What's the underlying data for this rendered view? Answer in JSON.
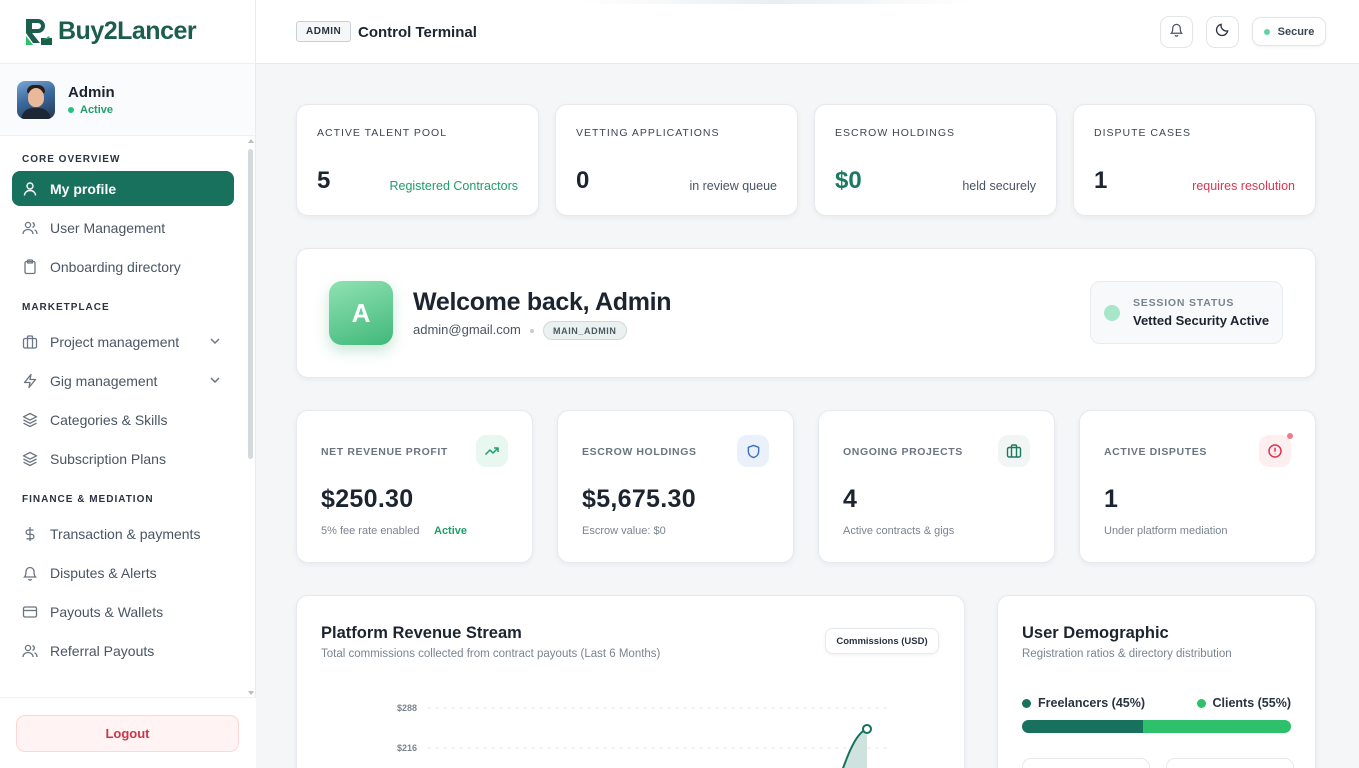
{
  "brand": {
    "name": "Buy2Lancer"
  },
  "user": {
    "name": "Admin",
    "status": "Active"
  },
  "nav": {
    "sections": [
      {
        "title": "CORE OVERVIEW"
      },
      {
        "title": "MARKETPLACE"
      },
      {
        "title": "FINANCE & MEDIATION"
      }
    ],
    "items": [
      {
        "label": "My profile",
        "icon": "user-icon"
      },
      {
        "label": "User Management",
        "icon": "users-icon"
      },
      {
        "label": "Onboarding directory",
        "icon": "clipboard-icon"
      },
      {
        "label": "Project management",
        "icon": "briefcase-icon"
      },
      {
        "label": "Gig management",
        "icon": "bolt-icon"
      },
      {
        "label": "Categories & Skills",
        "icon": "layers-icon"
      },
      {
        "label": "Subscription Plans",
        "icon": "layers-icon"
      },
      {
        "label": "Transaction & payments",
        "icon": "dollar-icon"
      },
      {
        "label": "Disputes & Alerts",
        "icon": "bell-icon"
      },
      {
        "label": "Payouts & Wallets",
        "icon": "card-icon"
      },
      {
        "label": "Referral Payouts",
        "icon": "users-icon"
      }
    ],
    "logout": "Logout"
  },
  "topbar": {
    "tag": "ADMIN",
    "title": "Control Terminal",
    "secure": "Secure"
  },
  "stats": [
    {
      "label": "ACTIVE TALENT POOL",
      "value": "5",
      "sub": "Registered Contractors",
      "color": "#1f9d6b"
    },
    {
      "label": "VETTING APPLICATIONS",
      "value": "0",
      "sub": "in review queue",
      "color": "#4a5563"
    },
    {
      "label": "ESCROW HOLDINGS",
      "value": "$0",
      "sub": "held securely",
      "color": "#4a5563"
    },
    {
      "label": "DISPUTE CASES",
      "value": "1",
      "sub": "requires resolution",
      "color": "#e0334f"
    }
  ],
  "welcome": {
    "initial": "A",
    "title": "Welcome back, Admin",
    "email": "admin@gmail.com",
    "role": "MAIN_ADMIN",
    "session_label": "SESSION STATUS",
    "session_value": "Vetted Security Active"
  },
  "kpis": [
    {
      "label": "NET REVENUE PROFIT",
      "value": "$250.30",
      "sub": "5% fee rate enabled",
      "badge": "Active",
      "icon": "trending-up-icon"
    },
    {
      "label": "ESCROW HOLDINGS",
      "value": "$5,675.30",
      "sub": "Escrow value: $0",
      "icon": "shield-icon"
    },
    {
      "label": "ONGOING PROJECTS",
      "value": "4",
      "sub": "Active contracts & gigs",
      "icon": "briefcase-icon"
    },
    {
      "label": "ACTIVE DISPUTES",
      "value": "1",
      "sub": "Under platform mediation",
      "icon": "alert-circle-icon"
    }
  ],
  "revenue": {
    "title": "Platform Revenue Stream",
    "subtitle": "Total commissions collected from contract payouts (Last 6 Months)",
    "pill": "Commissions (USD)"
  },
  "chart_data": {
    "type": "area",
    "title": "Platform Revenue Stream",
    "y_ticks": [
      "$288",
      "$216"
    ],
    "ylim": [
      0,
      288
    ],
    "series": [
      {
        "values": [
          0,
          0,
          0,
          0,
          0,
          250.3
        ]
      }
    ],
    "grid": true
  },
  "demographic": {
    "title": "User Demographic",
    "subtitle": "Registration ratios & directory distribution",
    "freelancers_label": "Freelancers (45%)",
    "clients_label": "Clients (55%)",
    "freelancers_pct": 45,
    "clients_pct": 55,
    "colors": {
      "freelancers": "#17715c",
      "clients": "#2ec06a"
    }
  }
}
